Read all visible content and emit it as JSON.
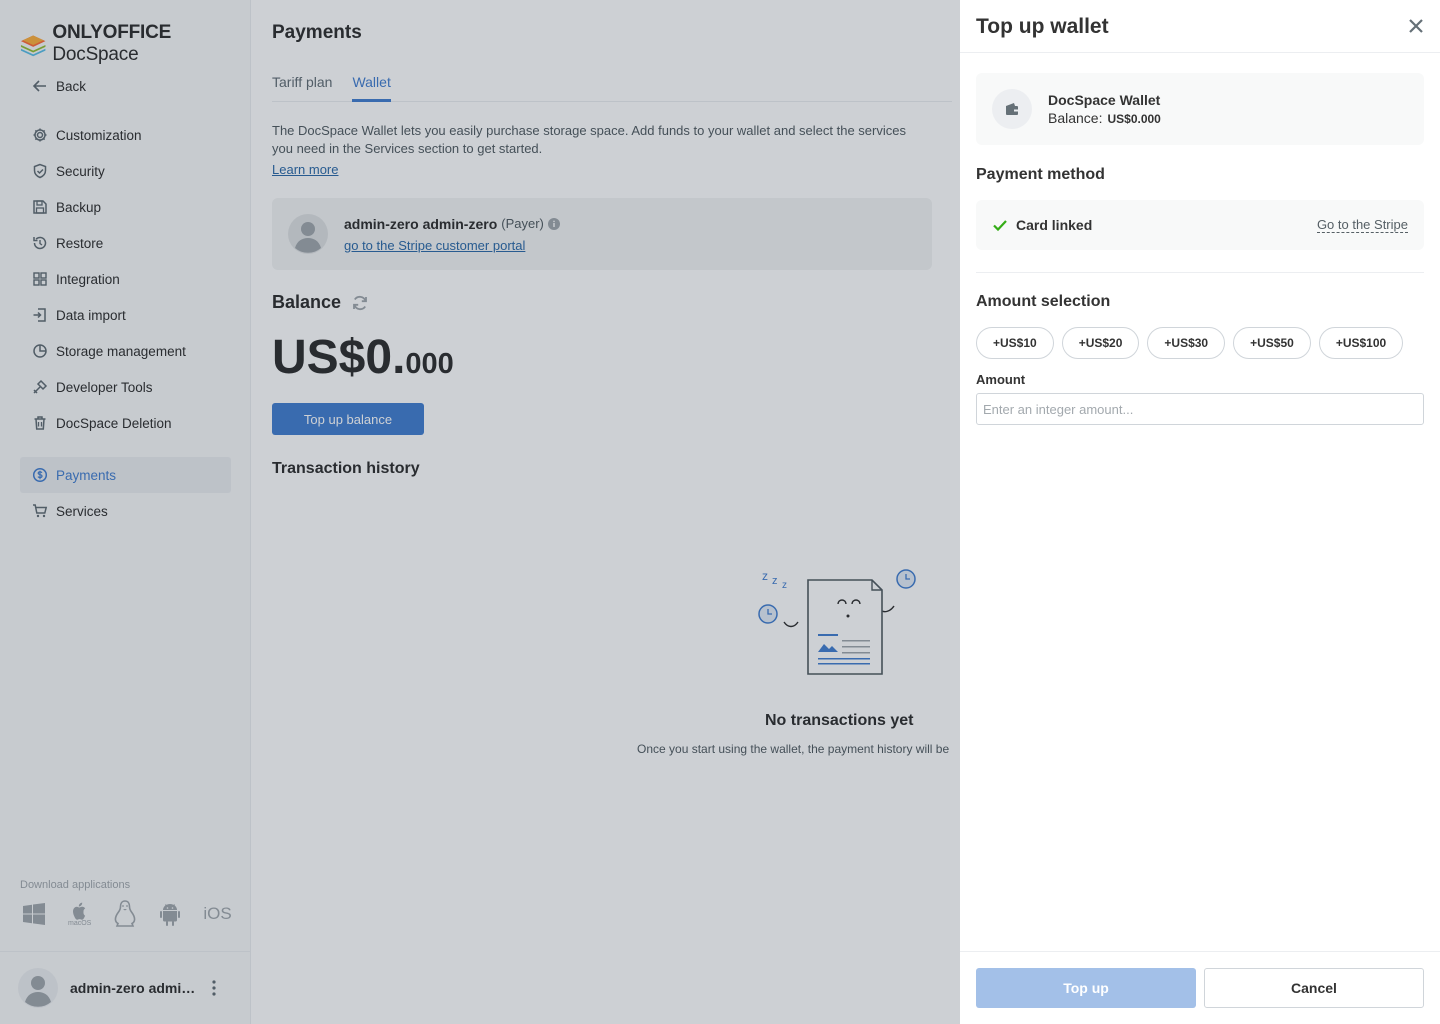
{
  "app": {
    "logo_brand": "ONLYOFFICE",
    "logo_product": "DocSpace",
    "accent_color": "#4781d1"
  },
  "sidebar": {
    "back_label": "Back",
    "items": [
      {
        "label": "Customization",
        "icon": "gear-icon"
      },
      {
        "label": "Security",
        "icon": "shield-icon"
      },
      {
        "label": "Backup",
        "icon": "floppy-icon"
      },
      {
        "label": "Restore",
        "icon": "restore-icon"
      },
      {
        "label": "Integration",
        "icon": "grid-icon"
      },
      {
        "label": "Data import",
        "icon": "import-icon"
      },
      {
        "label": "Storage management",
        "icon": "pie-icon"
      },
      {
        "label": "Developer Tools",
        "icon": "tools-icon"
      },
      {
        "label": "DocSpace Deletion",
        "icon": "trash-icon"
      }
    ],
    "payments_label": "Payments",
    "services_label": "Services",
    "download_title": "Download applications",
    "macos_label": "macOS",
    "ios_label": "iOS",
    "user_name": "admin-zero admin-zero"
  },
  "main": {
    "title": "Payments",
    "tabs": [
      {
        "label": "Tariff plan",
        "active": false
      },
      {
        "label": "Wallet",
        "active": true
      }
    ],
    "description": "The DocSpace Wallet lets you easily purchase storage space. Add funds to your wallet and select the services you need in the Services section to get started.",
    "learn_more": "Learn more",
    "payer_name": "admin-zero admin-zero",
    "payer_role": "(Payer)",
    "portal_link": "go to the Stripe customer portal",
    "balance_title": "Balance",
    "balance_main": "US$0.",
    "balance_decimals": "000",
    "topup_button": "Top up balance",
    "tx_title": "Transaction history",
    "empty_title": "No transactions yet",
    "empty_subtitle": "Once you start using the wallet, the payment history will be"
  },
  "panel": {
    "title": "Top up wallet",
    "wallet_name": "DocSpace Wallet",
    "balance_label": "Balance:",
    "balance_value": "US$0.000",
    "payment_method_title": "Payment method",
    "card_status": "Card linked",
    "stripe_link": "Go to the Stripe",
    "amount_selection_title": "Amount selection",
    "chips": [
      "+US$10",
      "+US$20",
      "+US$30",
      "+US$50",
      "+US$100"
    ],
    "amount_label": "Amount",
    "amount_placeholder": "Enter an integer amount...",
    "topup_label": "Top up",
    "cancel_label": "Cancel"
  }
}
